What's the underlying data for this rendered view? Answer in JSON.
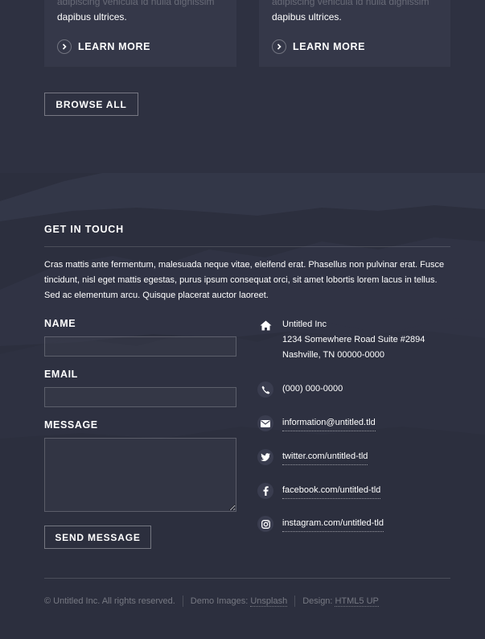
{
  "cards": [
    {
      "faded_text": "adipiscing vehicula id nulla dignissim",
      "text": "dapibus ultrices.",
      "link_label": "LEARN MORE"
    },
    {
      "faded_text": "adipiscing vehicula id nulla dignissim",
      "text": "dapibus ultrices.",
      "link_label": "LEARN MORE"
    }
  ],
  "browse_all_label": "BROWSE ALL",
  "contact": {
    "title": "GET IN TOUCH",
    "intro": "Cras mattis ante fermentum, malesuada neque vitae, eleifend erat. Phasellus non pulvinar erat. Fusce tincidunt, nisl eget mattis egestas, purus ipsum consequat orci, sit amet lobortis lorem lacus in tellus. Sed ac elementum arcu. Quisque placerat auctor laoreet.",
    "form": {
      "name_label": "NAME",
      "email_label": "EMAIL",
      "message_label": "MESSAGE",
      "name_value": "",
      "email_value": "",
      "message_value": "",
      "send_label": "SEND MESSAGE"
    },
    "info": {
      "address_lines": [
        "Untitled Inc",
        "1234 Somewhere Road Suite #2894",
        "Nashville, TN 00000-0000"
      ],
      "phone": "(000) 000-0000",
      "email": "information@untitled.tld",
      "twitter": "twitter.com/untitled-tld",
      "facebook": "facebook.com/untitled-tld",
      "instagram": "instagram.com/untitled-tld"
    },
    "icons": {
      "address": "home-icon",
      "phone": "phone-icon",
      "email": "envelope-icon",
      "twitter": "twitter-icon",
      "facebook": "facebook-icon",
      "instagram": "instagram-icon"
    }
  },
  "footer": {
    "copyright": "© Untitled Inc. All rights reserved.",
    "demo_images_label": "Demo Images:",
    "demo_images_link": "Unsplash",
    "design_label": "Design:",
    "design_link": "HTML5 UP"
  },
  "colors": {
    "background": "#2e3141",
    "card": "#353849",
    "text": "#ffffff"
  }
}
